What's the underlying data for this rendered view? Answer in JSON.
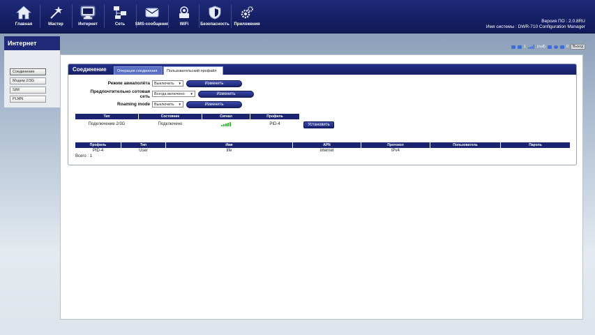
{
  "nav": {
    "items": [
      {
        "label": "Главная",
        "icon": "home-icon"
      },
      {
        "label": "Мастер",
        "icon": "wizard-icon"
      },
      {
        "label": "Интернет",
        "icon": "internet-icon"
      },
      {
        "label": "Сеть",
        "icon": "network-icon"
      },
      {
        "label": "SMS-сообщения",
        "icon": "sms-icon"
      },
      {
        "label": "WiFi",
        "icon": "wifi-icon"
      },
      {
        "label": "Безопасность",
        "icon": "security-icon"
      },
      {
        "label": "Приложения",
        "icon": "apps-icon"
      }
    ]
  },
  "system": {
    "firmware": "Версия ПО : 2.0.8RU",
    "system_name": "Имя системы : DWR-710 Configuration Manager"
  },
  "status": {
    "sms_count": "1",
    "network": "(null)",
    "messages": "0",
    "logout": "Выход"
  },
  "sidebar": {
    "title": "Интернет",
    "items": [
      {
        "label": "Соединение"
      },
      {
        "label": "Модем 2/3G"
      },
      {
        "label": "SIM"
      },
      {
        "label": "PLMN"
      }
    ]
  },
  "section": {
    "title": "Соединение",
    "tabs": [
      {
        "label": "Операция соединения"
      },
      {
        "label": "Пользовательский профайл"
      }
    ]
  },
  "form": {
    "airplane_label": "Режим авиаполёта",
    "airplane_value": "Выключить",
    "cellnet_label_1": "Предпочтительно сотовая",
    "cellnet_label_2": "сеть",
    "cellnet_value": "Всегда включено",
    "roaming_label": "Roaming mode",
    "roaming_value": "Выключить",
    "change_label": "Изменить"
  },
  "conn_table": {
    "headers": [
      "Тип",
      "Состояние",
      "Сигнал",
      "Профиль"
    ],
    "row": {
      "type": "Подключение 2/3G",
      "state": "Подключено",
      "signal_level": 5,
      "profile": "PID-4"
    },
    "install_label": "Установить"
  },
  "profile_table": {
    "headers": [
      "Профиль",
      "Тип",
      "Имя",
      "APN",
      "Протокол",
      "Пользователь",
      "Пароль"
    ],
    "row": {
      "profile": "PID-4",
      "type": "User",
      "name": "life",
      "apn": "internet",
      "protocol": "IPv4",
      "user": "",
      "password": ""
    },
    "total": "Всего : 1"
  },
  "colors": {
    "header_bg": "#151f63",
    "accent": "#1a2470",
    "signal": "#2fc12f"
  }
}
